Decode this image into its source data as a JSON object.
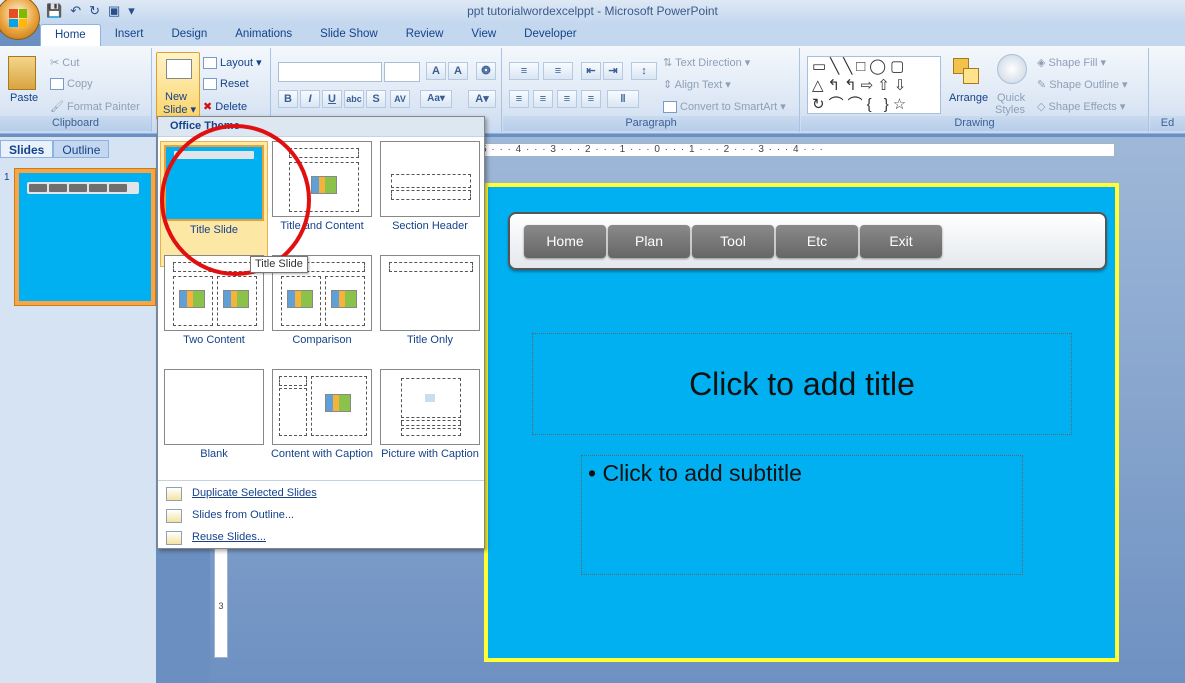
{
  "window": {
    "title": "ppt tutorialwordexcelppt - Microsoft PowerPoint"
  },
  "ribbon_tabs": [
    "Home",
    "Insert",
    "Design",
    "Animations",
    "Slide Show",
    "Review",
    "View",
    "Developer"
  ],
  "clipboard": {
    "paste": "Paste",
    "cut": "Cut",
    "copy": "Copy",
    "format_painter": "Format Painter",
    "group": "Clipboard"
  },
  "slides_group": {
    "new_slide_line1": "New",
    "new_slide_line2": "Slide",
    "layout": "Layout",
    "reset": "Reset",
    "delete": "Delete"
  },
  "paragraph": {
    "text_direction": "Text Direction",
    "align_text": "Align Text",
    "convert_smartart": "Convert to SmartArt",
    "group": "Paragraph"
  },
  "drawing": {
    "arrange": "Arrange",
    "quick_styles_line1": "Quick",
    "quick_styles_line2": "Styles",
    "shape_fill": "Shape Fill",
    "shape_outline": "Shape Outline",
    "shape_effects": "Shape Effects",
    "group": "Drawing"
  },
  "edit_group_partial": "Ed",
  "left_panel": {
    "tab_slides": "Slides",
    "tab_outline": "Outline",
    "slide_number": "1"
  },
  "ruler_h_text": "5 · · · 4 · · · 3 · · · 2 · · · 1 · · · 0 · · · 1 · · · 2 · · · 3 · · · 4 · · ·",
  "ruler_v_text": "3",
  "dropdown": {
    "header": "Office Theme",
    "layouts": [
      "Title Slide",
      "Title and Content",
      "Section Header",
      "Two Content",
      "Comparison",
      "Title Only",
      "Blank",
      "Content with Caption",
      "Picture with Caption"
    ],
    "menu": [
      "Duplicate Selected Slides",
      "Slides from Outline...",
      "Reuse Slides..."
    ]
  },
  "tooltip": "Title Slide",
  "slide": {
    "nav_buttons": [
      "Home",
      "Plan",
      "Tool",
      "Etc",
      "Exit"
    ],
    "title_placeholder": "Click to add title",
    "subtitle_placeholder": "Click to add subtitle",
    "bullet": "•"
  },
  "colors": {
    "slide_bg": "#00b0f0",
    "slide_border": "#ffff33",
    "highlight_circle": "#e01010"
  }
}
